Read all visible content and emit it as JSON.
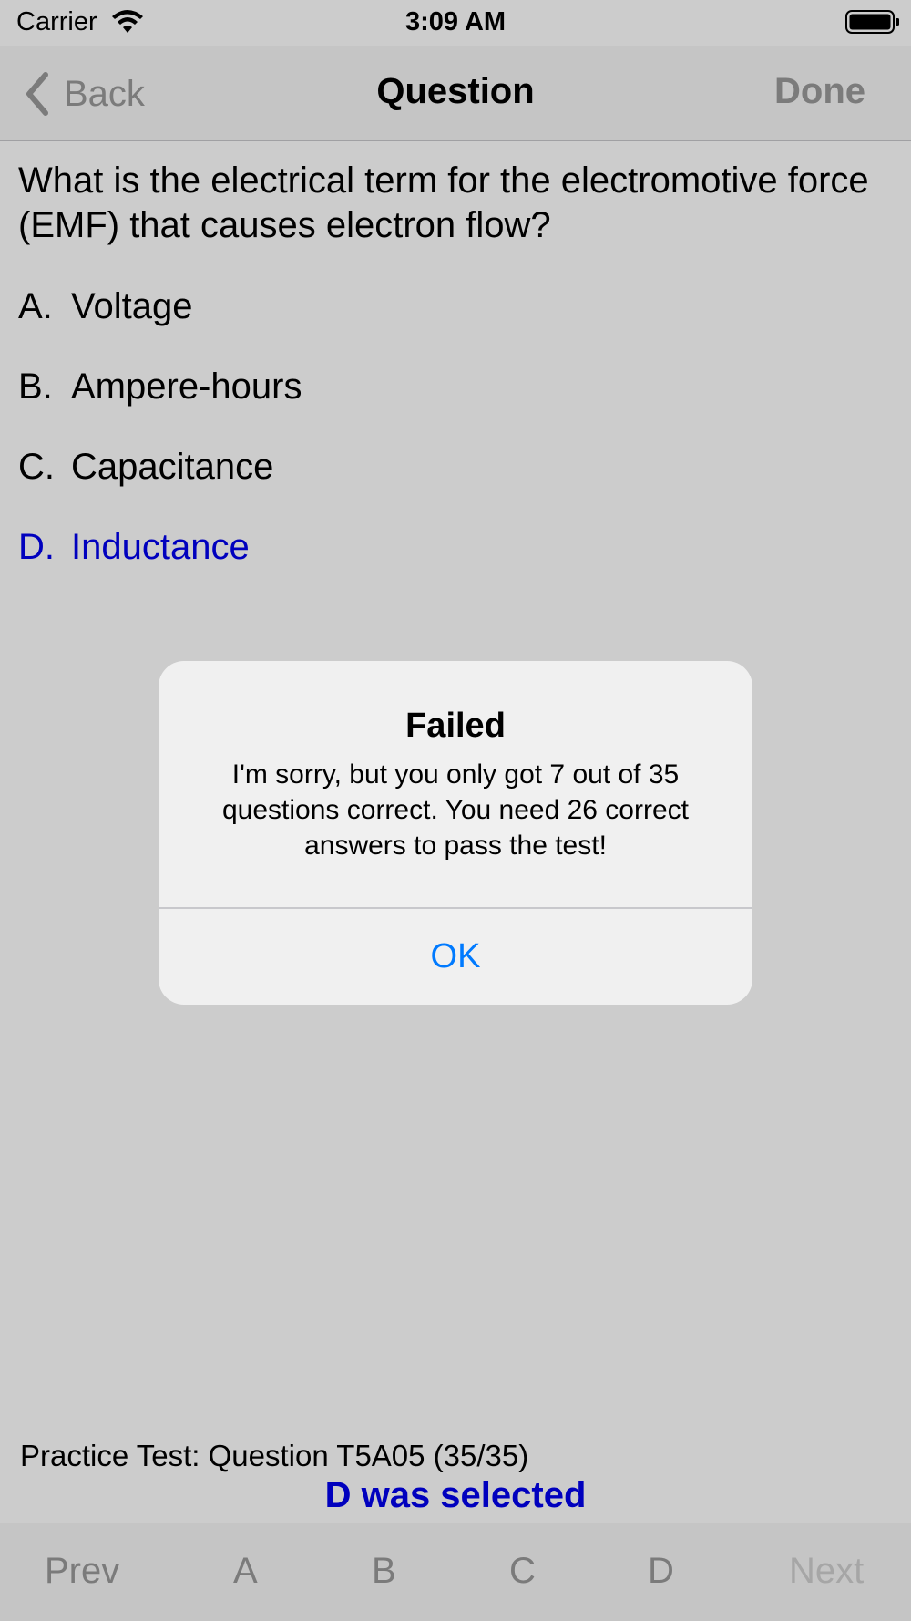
{
  "status_bar": {
    "carrier": "Carrier",
    "time": "3:09 AM",
    "wifi_icon": "wifi-icon",
    "battery_icon": "battery-icon"
  },
  "nav": {
    "back_label": "Back",
    "title": "Question",
    "done_label": "Done"
  },
  "question": {
    "text": "What is the electrical term for the electromotive force (EMF) that causes electron flow?",
    "answers": [
      {
        "letter": "A.",
        "text": "Voltage",
        "selected": false
      },
      {
        "letter": "B.",
        "text": "Ampere-hours",
        "selected": false
      },
      {
        "letter": "C.",
        "text": "Capacitance",
        "selected": false
      },
      {
        "letter": "D.",
        "text": "Inductance",
        "selected": true
      }
    ]
  },
  "footer": {
    "info": "Practice Test:  Question T5A05 (35/35)",
    "selected_text": "D was selected"
  },
  "toolbar": {
    "prev": "Prev",
    "a": "A",
    "b": "B",
    "c": "C",
    "d": "D",
    "next": "Next"
  },
  "alert": {
    "title": "Failed",
    "message": "I'm sorry, but you only got 7 out of 35 questions correct.  You need 26 correct answers to pass the test!",
    "ok_label": "OK"
  },
  "colors": {
    "selected_answer": "#0000ee",
    "alert_button": "#007aff",
    "disabled_text": "#9a9a9a"
  }
}
